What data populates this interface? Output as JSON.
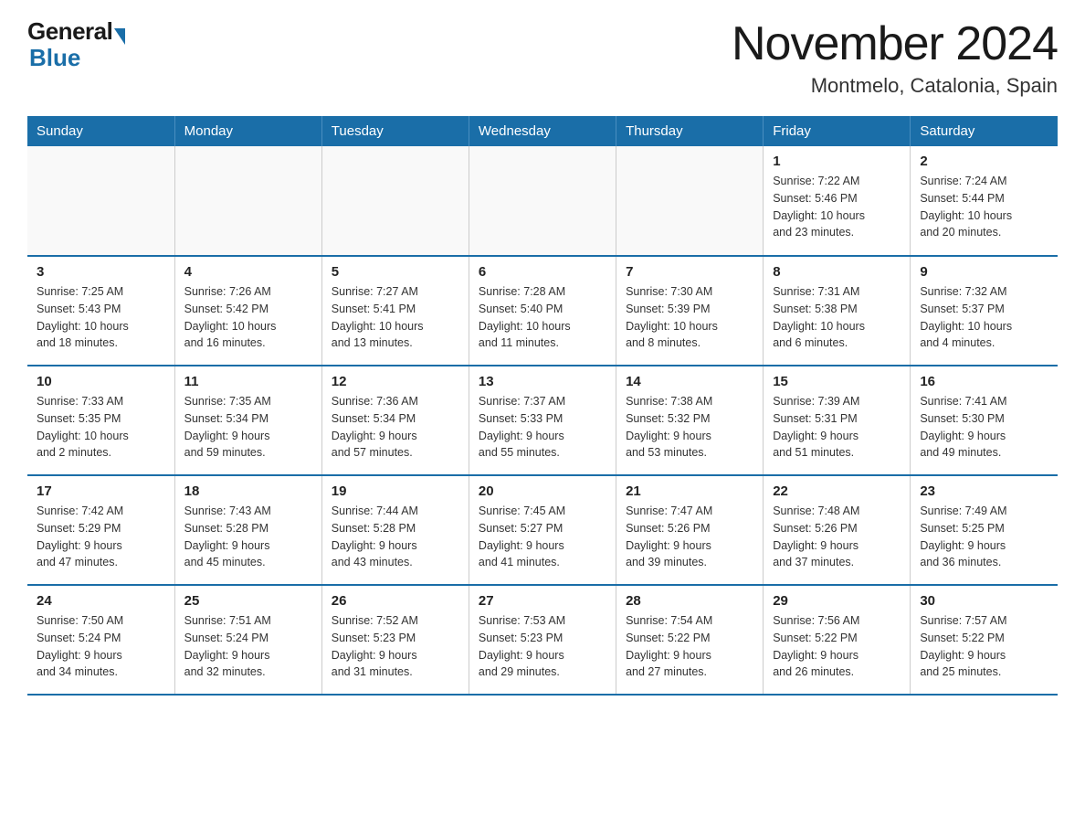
{
  "header": {
    "logo": {
      "general": "General",
      "blue": "Blue",
      "triangle_color": "#1a6ea8"
    },
    "month": "November 2024",
    "location": "Montmelo, Catalonia, Spain"
  },
  "calendar": {
    "days_of_week": [
      "Sunday",
      "Monday",
      "Tuesday",
      "Wednesday",
      "Thursday",
      "Friday",
      "Saturday"
    ],
    "weeks": [
      [
        {
          "day": "",
          "info": ""
        },
        {
          "day": "",
          "info": ""
        },
        {
          "day": "",
          "info": ""
        },
        {
          "day": "",
          "info": ""
        },
        {
          "day": "",
          "info": ""
        },
        {
          "day": "1",
          "info": "Sunrise: 7:22 AM\nSunset: 5:46 PM\nDaylight: 10 hours\nand 23 minutes."
        },
        {
          "day": "2",
          "info": "Sunrise: 7:24 AM\nSunset: 5:44 PM\nDaylight: 10 hours\nand 20 minutes."
        }
      ],
      [
        {
          "day": "3",
          "info": "Sunrise: 7:25 AM\nSunset: 5:43 PM\nDaylight: 10 hours\nand 18 minutes."
        },
        {
          "day": "4",
          "info": "Sunrise: 7:26 AM\nSunset: 5:42 PM\nDaylight: 10 hours\nand 16 minutes."
        },
        {
          "day": "5",
          "info": "Sunrise: 7:27 AM\nSunset: 5:41 PM\nDaylight: 10 hours\nand 13 minutes."
        },
        {
          "day": "6",
          "info": "Sunrise: 7:28 AM\nSunset: 5:40 PM\nDaylight: 10 hours\nand 11 minutes."
        },
        {
          "day": "7",
          "info": "Sunrise: 7:30 AM\nSunset: 5:39 PM\nDaylight: 10 hours\nand 8 minutes."
        },
        {
          "day": "8",
          "info": "Sunrise: 7:31 AM\nSunset: 5:38 PM\nDaylight: 10 hours\nand 6 minutes."
        },
        {
          "day": "9",
          "info": "Sunrise: 7:32 AM\nSunset: 5:37 PM\nDaylight: 10 hours\nand 4 minutes."
        }
      ],
      [
        {
          "day": "10",
          "info": "Sunrise: 7:33 AM\nSunset: 5:35 PM\nDaylight: 10 hours\nand 2 minutes."
        },
        {
          "day": "11",
          "info": "Sunrise: 7:35 AM\nSunset: 5:34 PM\nDaylight: 9 hours\nand 59 minutes."
        },
        {
          "day": "12",
          "info": "Sunrise: 7:36 AM\nSunset: 5:34 PM\nDaylight: 9 hours\nand 57 minutes."
        },
        {
          "day": "13",
          "info": "Sunrise: 7:37 AM\nSunset: 5:33 PM\nDaylight: 9 hours\nand 55 minutes."
        },
        {
          "day": "14",
          "info": "Sunrise: 7:38 AM\nSunset: 5:32 PM\nDaylight: 9 hours\nand 53 minutes."
        },
        {
          "day": "15",
          "info": "Sunrise: 7:39 AM\nSunset: 5:31 PM\nDaylight: 9 hours\nand 51 minutes."
        },
        {
          "day": "16",
          "info": "Sunrise: 7:41 AM\nSunset: 5:30 PM\nDaylight: 9 hours\nand 49 minutes."
        }
      ],
      [
        {
          "day": "17",
          "info": "Sunrise: 7:42 AM\nSunset: 5:29 PM\nDaylight: 9 hours\nand 47 minutes."
        },
        {
          "day": "18",
          "info": "Sunrise: 7:43 AM\nSunset: 5:28 PM\nDaylight: 9 hours\nand 45 minutes."
        },
        {
          "day": "19",
          "info": "Sunrise: 7:44 AM\nSunset: 5:28 PM\nDaylight: 9 hours\nand 43 minutes."
        },
        {
          "day": "20",
          "info": "Sunrise: 7:45 AM\nSunset: 5:27 PM\nDaylight: 9 hours\nand 41 minutes."
        },
        {
          "day": "21",
          "info": "Sunrise: 7:47 AM\nSunset: 5:26 PM\nDaylight: 9 hours\nand 39 minutes."
        },
        {
          "day": "22",
          "info": "Sunrise: 7:48 AM\nSunset: 5:26 PM\nDaylight: 9 hours\nand 37 minutes."
        },
        {
          "day": "23",
          "info": "Sunrise: 7:49 AM\nSunset: 5:25 PM\nDaylight: 9 hours\nand 36 minutes."
        }
      ],
      [
        {
          "day": "24",
          "info": "Sunrise: 7:50 AM\nSunset: 5:24 PM\nDaylight: 9 hours\nand 34 minutes."
        },
        {
          "day": "25",
          "info": "Sunrise: 7:51 AM\nSunset: 5:24 PM\nDaylight: 9 hours\nand 32 minutes."
        },
        {
          "day": "26",
          "info": "Sunrise: 7:52 AM\nSunset: 5:23 PM\nDaylight: 9 hours\nand 31 minutes."
        },
        {
          "day": "27",
          "info": "Sunrise: 7:53 AM\nSunset: 5:23 PM\nDaylight: 9 hours\nand 29 minutes."
        },
        {
          "day": "28",
          "info": "Sunrise: 7:54 AM\nSunset: 5:22 PM\nDaylight: 9 hours\nand 27 minutes."
        },
        {
          "day": "29",
          "info": "Sunrise: 7:56 AM\nSunset: 5:22 PM\nDaylight: 9 hours\nand 26 minutes."
        },
        {
          "day": "30",
          "info": "Sunrise: 7:57 AM\nSunset: 5:22 PM\nDaylight: 9 hours\nand 25 minutes."
        }
      ]
    ]
  }
}
